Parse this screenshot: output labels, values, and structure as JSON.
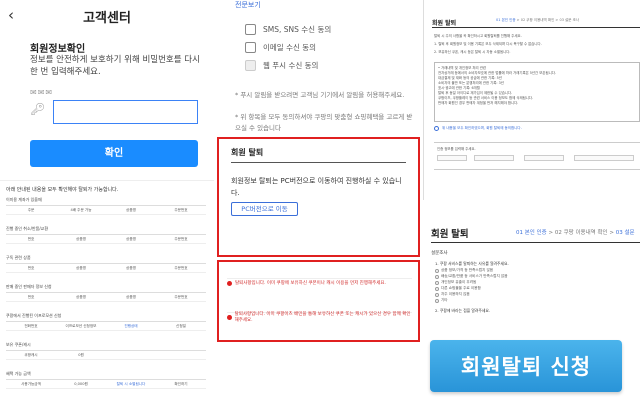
{
  "mobile": {
    "back_icon": "chevron-left-icon",
    "title": "고객센터",
    "heading": "회원정보확인",
    "description": "정보를 안전하게 보호하기 위해 비밀번호를 다시 한 번 입력해주세요.",
    "id_masked": "✉✉✉",
    "password_value": "",
    "confirm_label": "확인",
    "accent": "#1a8cff"
  },
  "withdraw_form": {
    "top_text": "아래 안내된 내용을 모두 확인해야 탈퇴가 가능합니다.",
    "sections": [
      {
        "title": "이미용 계좌가 있을때",
        "cols": [
          "주문",
          "4배 주문 가능",
          "상품명",
          "주문번호"
        ]
      },
      {
        "title": "진행 중인 취소/반품/교환",
        "cols": [
          "번호",
          "상품명",
          "상품명",
          "주문번호"
        ]
      },
      {
        "title": "구독 관련 상품",
        "cols": [
          "번호",
          "상품명",
          "상품명",
          "주문번호"
        ]
      },
      {
        "title": "판매 중인 판매자 정보 신청",
        "cols": [
          "번호",
          "상품명",
          "상품명",
          "주문번호"
        ]
      },
      {
        "title": "쿠팡에서 진행된 이프로모션 신청",
        "cols": [
          "전화번호",
          "이프로모션 신청정보",
          "진행상태",
          "신청일"
        ]
      },
      {
        "title": "보유 쿠폰/캐시",
        "cols": [
          "쿠팡캐시",
          "0원",
          "",
          ""
        ]
      },
      {
        "title": "혜택 가능 금액",
        "cols": [
          "사용가능금액",
          "0,000원",
          "탈퇴 시 소멸됩니다",
          "확인하기"
        ]
      }
    ]
  },
  "consent": {
    "link": "전문보기",
    "items": [
      "SMS, SNS 수신 동의",
      "이메일 수신 동의",
      "웹 푸시 수신 동의"
    ],
    "note1": "* 푸시 알림을 받으려면 고객님 기기에서 알림을 허용해주세요.",
    "note2": "* 위 항목을 모두 동의하셔야 쿠팡의 맞춤형 쇼핑혜택을 고르게 받으실 수 있습니다"
  },
  "withdraw_box": {
    "title": "회원 탈퇴",
    "text": "회원정보 탈퇴는 PC버전으로 이동하여 진행하실 수 있습니다.",
    "button": "PC버전으로 이동",
    "border_color": "#e02020"
  },
  "warnings": {
    "items": [
      "탈퇴사항입니다. 이미 쿠팡에 보유하신 쿠폰이나 캐시 이용을 먼저 진행해주세요.",
      "탈퇴사항입니다. 이미 쿠팡이츠 배민을 통해 보유하신 쿠폰 또는 캐시가 있으신 경우 함께 확인해주세요."
    ]
  },
  "desktop": {
    "title": "회원 탈퇴",
    "steps": [
      "01 본인 인증",
      "02 쿠팡 이용내역 확인",
      "03 설문 조사"
    ],
    "paras": [
      "탈퇴 시 주의 사항을 꼭 확인하시고 회원탈퇴를 진행해 주세요.",
      "1. 탈퇴 후 회원정보 및 이용 기록은 모두 삭제되며 다시 복구할 수 없습니다.",
      "2. 보유하신 쿠폰, 캐시 등은 탈퇴 시 자동 소멸됩니다."
    ],
    "box_lines": [
      "• 거래내역 및 개인정보 처리 관련",
      "전자상거래 등에서의 소비자보호에 관한 법률에 따라 거래기록은 5년간 보존됩니다.",
      "대금결제 및 재화 등의 공급에 관한 기록: 5년",
      "소비자의 불만 또는 분쟁처리에 관한 기록: 3년",
      "표시·광고에 관한 기록: 6개월",
      "탈퇴 후 동일 아이디로 재가입이 제한될 수 있습니다.",
      "쿠팡이츠, 쿠팡플레이 등 관련 서비스 이용 정보도 함께 삭제됩니다.",
      "판매자 회원인 경우 판매자 계정을 먼저 해지해야 합니다."
    ],
    "agree": "위 내용을 모두 확인하였으며, 회원 탈퇴에 동의합니다.",
    "form_label": "인증 정보를 입력해 주세요."
  },
  "survey": {
    "title": "회원 탈퇴",
    "steps": [
      "01 본인 인증",
      "02 쿠팡 이용내역 확인",
      "03 설문"
    ],
    "subtitle": "설문조사",
    "q1": "1. 쿠팡 서비스를 탈퇴하는 사유를 알려주세요.",
    "options": [
      "상품 정보/가격 등 만족스럽지 않음",
      "배송/교환/반품 등 서비스가 만족스럽지 않음",
      "개인정보 유출이 우려됨",
      "다른 쇼핑몰을 주로 이용함",
      "자주 이용하지 않음",
      "기타"
    ],
    "q2": "2. 쿠팡에 바라는 점을 알려주세요."
  },
  "big_button": {
    "label": "회원탈퇴 신청",
    "color": "#2994d8"
  }
}
